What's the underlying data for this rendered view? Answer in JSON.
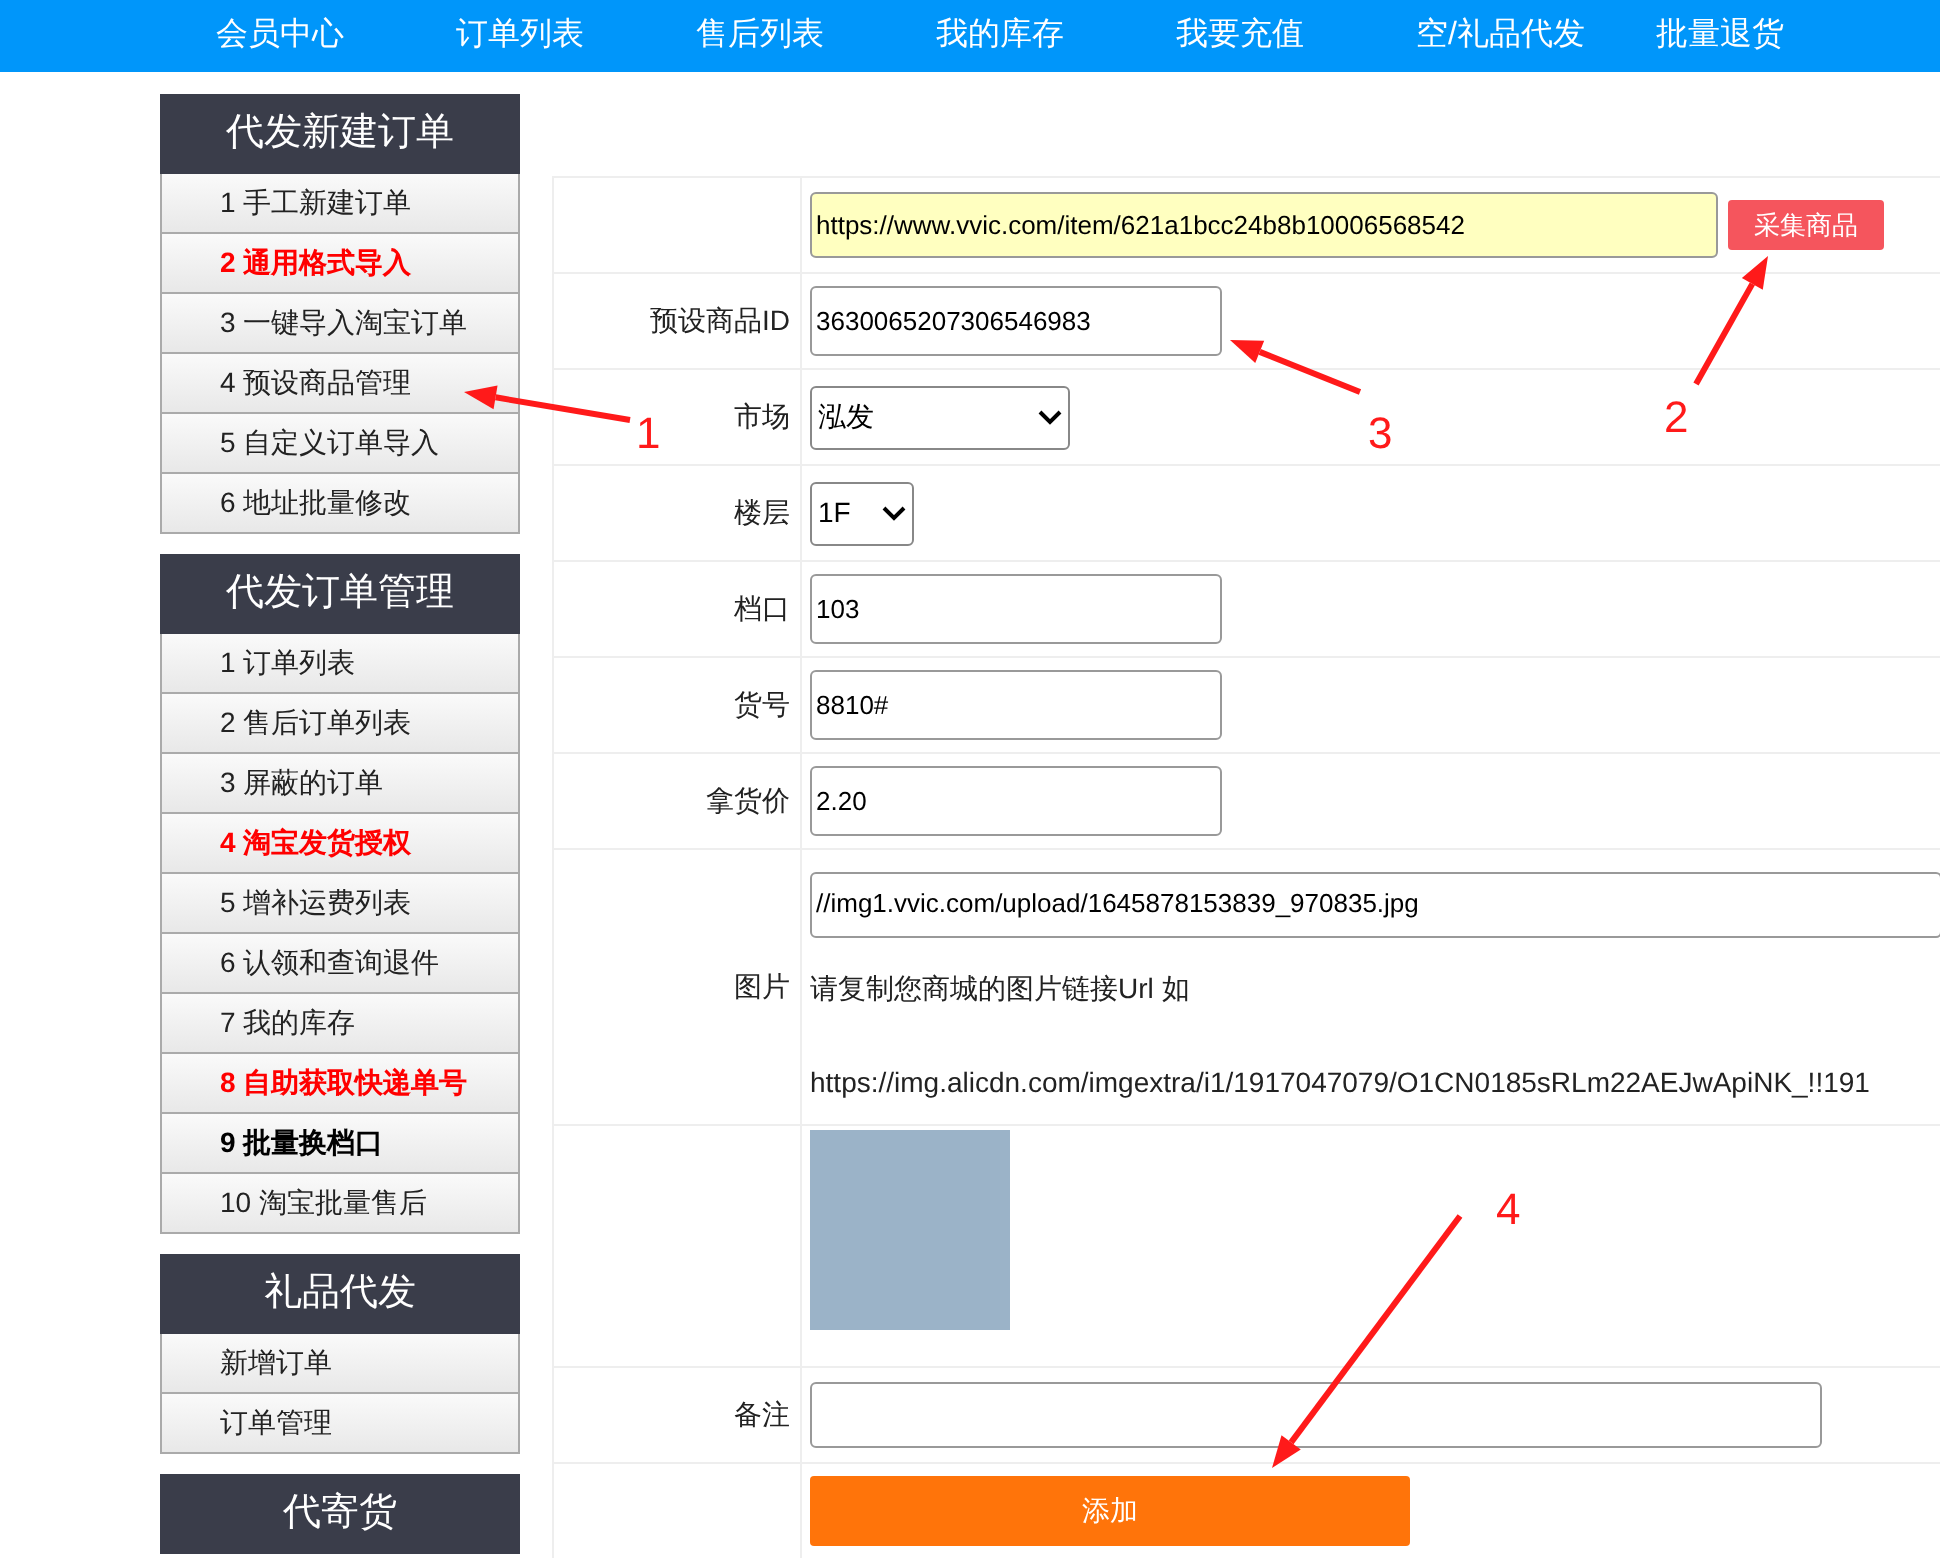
{
  "nav": [
    "会员中心",
    "订单列表",
    "售后列表",
    "我的库存",
    "我要充值",
    "空/礼品代发",
    "批量退货"
  ],
  "sidebar": [
    {
      "title": "代发新建订单",
      "items": [
        {
          "label": "1 手工新建订单",
          "kind": "normal"
        },
        {
          "label": "2 通用格式导入",
          "kind": "highlight"
        },
        {
          "label": "3 一键导入淘宝订单",
          "kind": "normal"
        },
        {
          "label": "4 预设商品管理",
          "kind": "normal"
        },
        {
          "label": "5 自定义订单导入",
          "kind": "normal"
        },
        {
          "label": "6 地址批量修改",
          "kind": "normal"
        }
      ]
    },
    {
      "title": "代发订单管理",
      "items": [
        {
          "label": "1 订单列表",
          "kind": "normal"
        },
        {
          "label": "2 售后订单列表",
          "kind": "normal"
        },
        {
          "label": "3 屏蔽的订单",
          "kind": "normal"
        },
        {
          "label": "4 淘宝发货授权",
          "kind": "highlight"
        },
        {
          "label": "5 增补运费列表",
          "kind": "normal"
        },
        {
          "label": "6 认领和查询退件",
          "kind": "normal"
        },
        {
          "label": "7 我的库存",
          "kind": "normal"
        },
        {
          "label": "8 自助获取快递单号",
          "kind": "highlight"
        },
        {
          "label": "9 批量换档口",
          "kind": "bold"
        },
        {
          "label": "10 淘宝批量售后",
          "kind": "normal"
        }
      ]
    },
    {
      "title": "礼品代发",
      "items": [
        {
          "label": "新增订单",
          "kind": "normal"
        },
        {
          "label": "订单管理",
          "kind": "normal"
        }
      ]
    },
    {
      "title": "代寄货"
    }
  ],
  "form": {
    "rows": [
      {
        "kind": "url",
        "value": "https://www.vvic.com/item/621a1bcc24b8b10006568542",
        "button": "采集商品"
      },
      {
        "kind": "text",
        "label": "预设商品ID",
        "value": "3630065207306546983"
      },
      {
        "kind": "select",
        "label": "市场",
        "value": "泓发"
      },
      {
        "kind": "select",
        "label": "楼层",
        "value": "1F"
      },
      {
        "kind": "text",
        "label": "档口",
        "value": "103"
      },
      {
        "kind": "text",
        "label": "货号",
        "value": "8810#"
      },
      {
        "kind": "text",
        "label": "拿货价",
        "value": "2.20"
      },
      {
        "kind": "picture",
        "label": "图片",
        "value": "//img1.vvic.com/upload/1645878153839_970835.jpg",
        "hint": "请复制您商城的图片链接Url 如",
        "example": "https://img.alicdn.com/imgextra/i1/1917047079/O1CN0185sRLm22AEJwApiNK_!!191"
      },
      {
        "kind": "photo"
      },
      {
        "kind": "textarea",
        "label": "备注"
      },
      {
        "kind": "submit",
        "button": "添加"
      }
    ]
  },
  "annotations": [
    {
      "label": "1"
    },
    {
      "label": "2"
    },
    {
      "label": "3"
    },
    {
      "label": "4"
    }
  ]
}
